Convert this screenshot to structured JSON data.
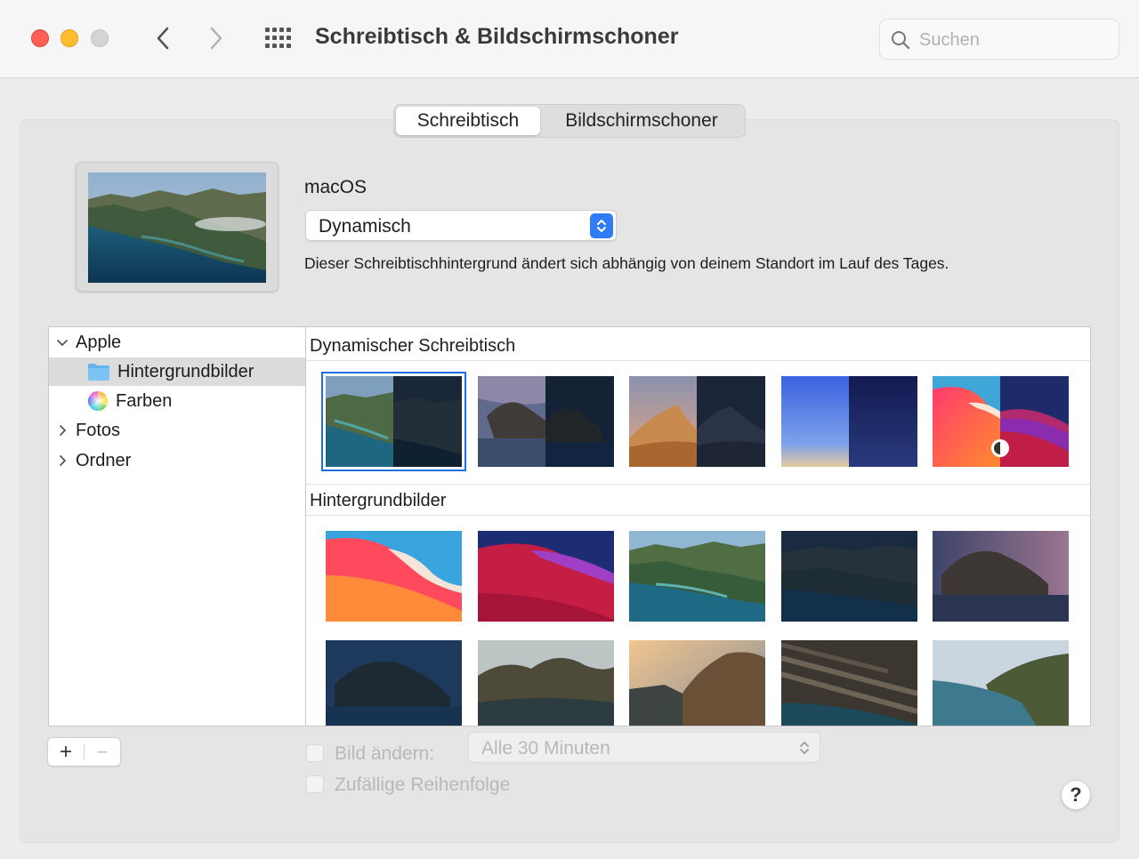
{
  "window": {
    "title": "Schreibtisch & Bildschirmschoner",
    "search_placeholder": "Suchen"
  },
  "tabs": [
    {
      "label": "Schreibtisch",
      "selected": true
    },
    {
      "label": "Bildschirmschoner",
      "selected": false
    }
  ],
  "current": {
    "folder_title": "macOS",
    "mode": "Dynamisch",
    "description": "Dieser Schreibtischhintergrund ändert sich abhängig von deinem Standort im Lauf des Tages."
  },
  "sidebar": {
    "items": [
      {
        "label": "Apple",
        "expanded": true,
        "icon": "chevron-down-icon"
      },
      {
        "label": "Hintergrundbilder",
        "selected": true,
        "icon": "folder-icon"
      },
      {
        "label": "Farben",
        "icon": "color-wheel-icon"
      },
      {
        "label": "Fotos",
        "expanded": false,
        "icon": "chevron-right-icon"
      },
      {
        "label": "Ordner",
        "expanded": false,
        "icon": "chevron-right-icon"
      }
    ]
  },
  "gallery": {
    "dynamic_header": "Dynamischer Schreibtisch",
    "wallpapers_header": "Hintergrundbilder"
  },
  "controls": {
    "add_label": "+",
    "remove_label": "−",
    "change_picture_label": "Bild ändern:",
    "change_interval": "Alle 30 Minuten",
    "random_order_label": "Zufällige Reihenfolge",
    "help_label": "?"
  },
  "colors": {
    "accent": "#2f7cf6",
    "close": "#ff5f57",
    "minimize": "#febc2e",
    "selection_outline": "#1f6fe4"
  }
}
